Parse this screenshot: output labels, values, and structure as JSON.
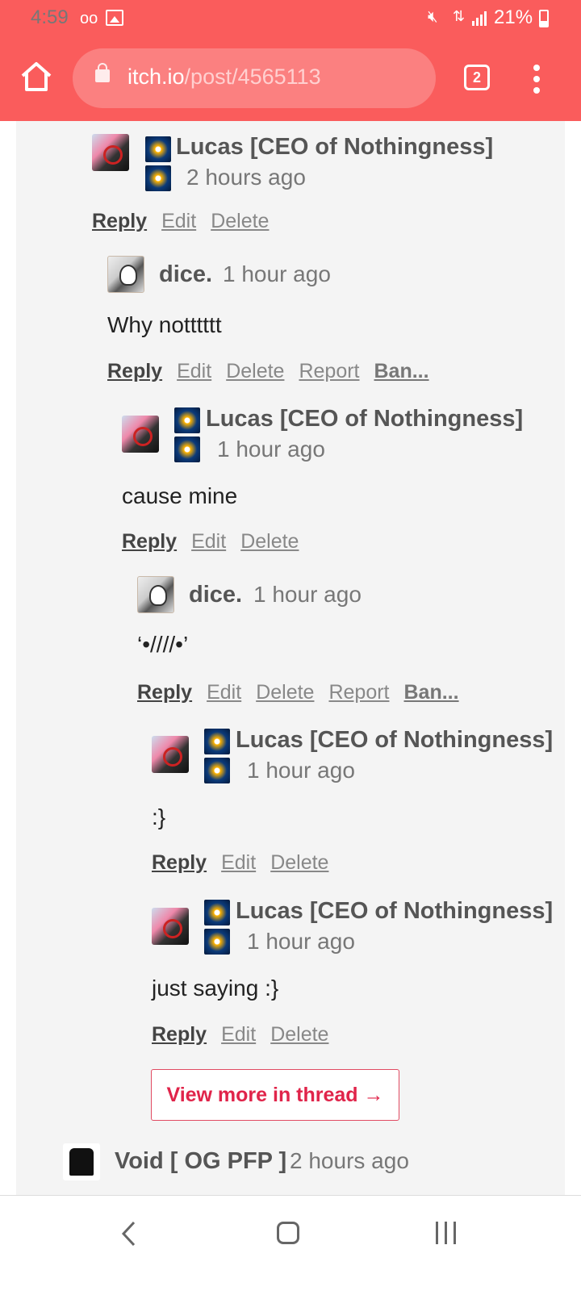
{
  "status_bar": {
    "time": "4:59",
    "voicemail_icon": "oo",
    "battery_text": "21%"
  },
  "browser": {
    "url_host": "itch.io",
    "url_path": "/post/4565113",
    "tab_count": "2"
  },
  "thread": {
    "comments": [
      {
        "author": "Lucas [CEO of Nothingness]",
        "time": "2 hours ago",
        "text": "",
        "actions": [
          "Reply",
          "Edit",
          "Delete"
        ]
      },
      {
        "author": "dice.",
        "time": "1 hour ago",
        "text": "Why notttttt",
        "actions": [
          "Reply",
          "Edit",
          "Delete",
          "Report",
          "Ban..."
        ]
      },
      {
        "author": "Lucas [CEO of Nothingness]",
        "time": "1 hour ago",
        "text": "cause mine",
        "actions": [
          "Reply",
          "Edit",
          "Delete"
        ]
      },
      {
        "author": "dice.",
        "time": "1 hour ago",
        "text": "‘•////•’",
        "actions": [
          "Reply",
          "Edit",
          "Delete",
          "Report",
          "Ban..."
        ]
      },
      {
        "author": "Lucas [CEO of Nothingness]",
        "time": "1 hour ago",
        "text": ":}",
        "actions": [
          "Reply",
          "Edit",
          "Delete"
        ]
      },
      {
        "author": "Lucas [CEO of Nothingness]",
        "time": "1 hour ago",
        "text": "just saying :}",
        "actions": [
          "Reply",
          "Edit",
          "Delete"
        ]
      }
    ],
    "view_more_label": "View more in thread →",
    "next_comment": {
      "author": "Void [ OG PFP ]",
      "time": "2 hours ago"
    }
  },
  "icons": {
    "home": "home-icon",
    "lock": "lock-icon",
    "menu": "more-vert-icon",
    "back": "back-icon",
    "nav_home": "nav-home-icon",
    "recent": "recent-apps-icon"
  },
  "colors": {
    "accent": "#fa5c5c",
    "link_red": "#e0244a"
  }
}
